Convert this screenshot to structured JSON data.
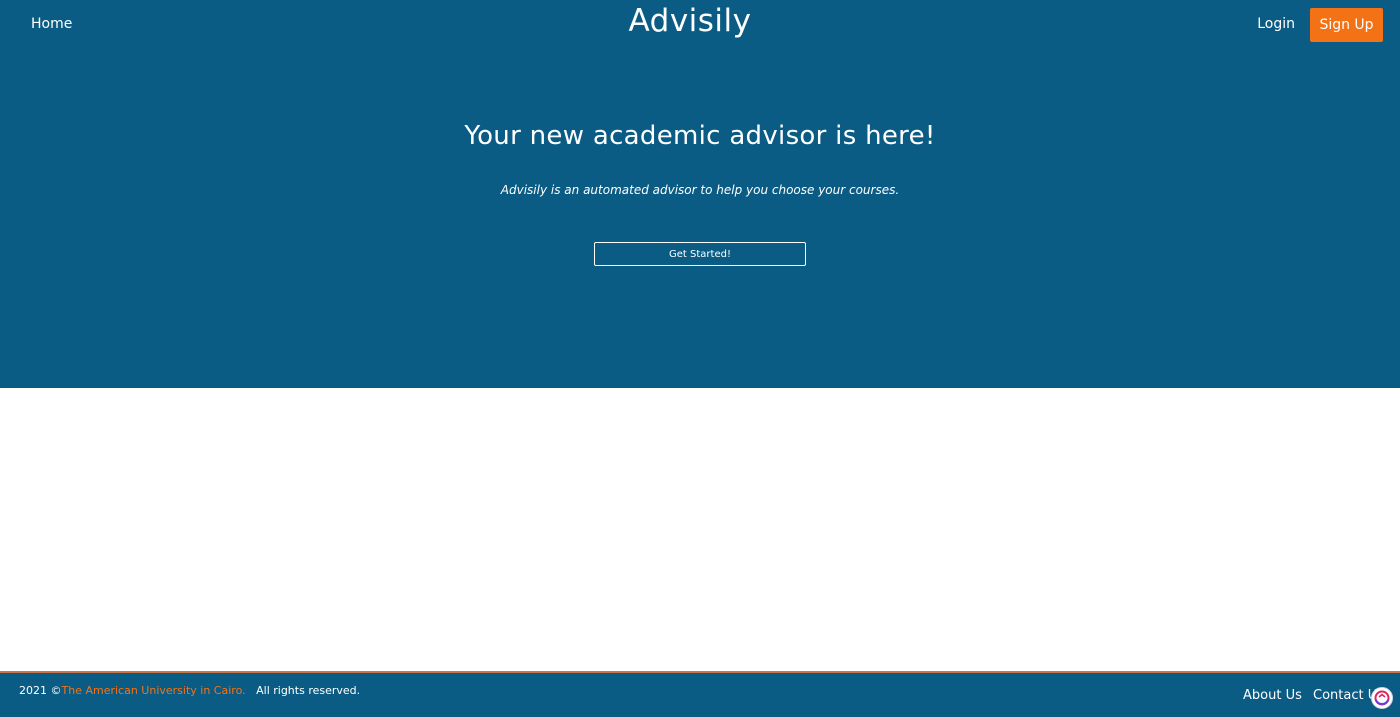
{
  "nav": {
    "home": "Home",
    "brand": "Advisily",
    "login": "Login",
    "signup": "Sign Up"
  },
  "hero": {
    "headline": "Your new academic advisor is here!",
    "subline": "Advisily is an automated advisor to help you choose your courses.",
    "cta": "Get Started!"
  },
  "footer": {
    "year": "2021 ©",
    "university": "The American University in Cairo.",
    "rights": "All rights reserved.",
    "about": "About Us",
    "contact": "Contact Us"
  },
  "colors": {
    "primary": "#0b5c84",
    "accent": "#f47216",
    "background": "#ffffff"
  },
  "icons": {
    "helper_badge": "chat-helper-icon"
  }
}
